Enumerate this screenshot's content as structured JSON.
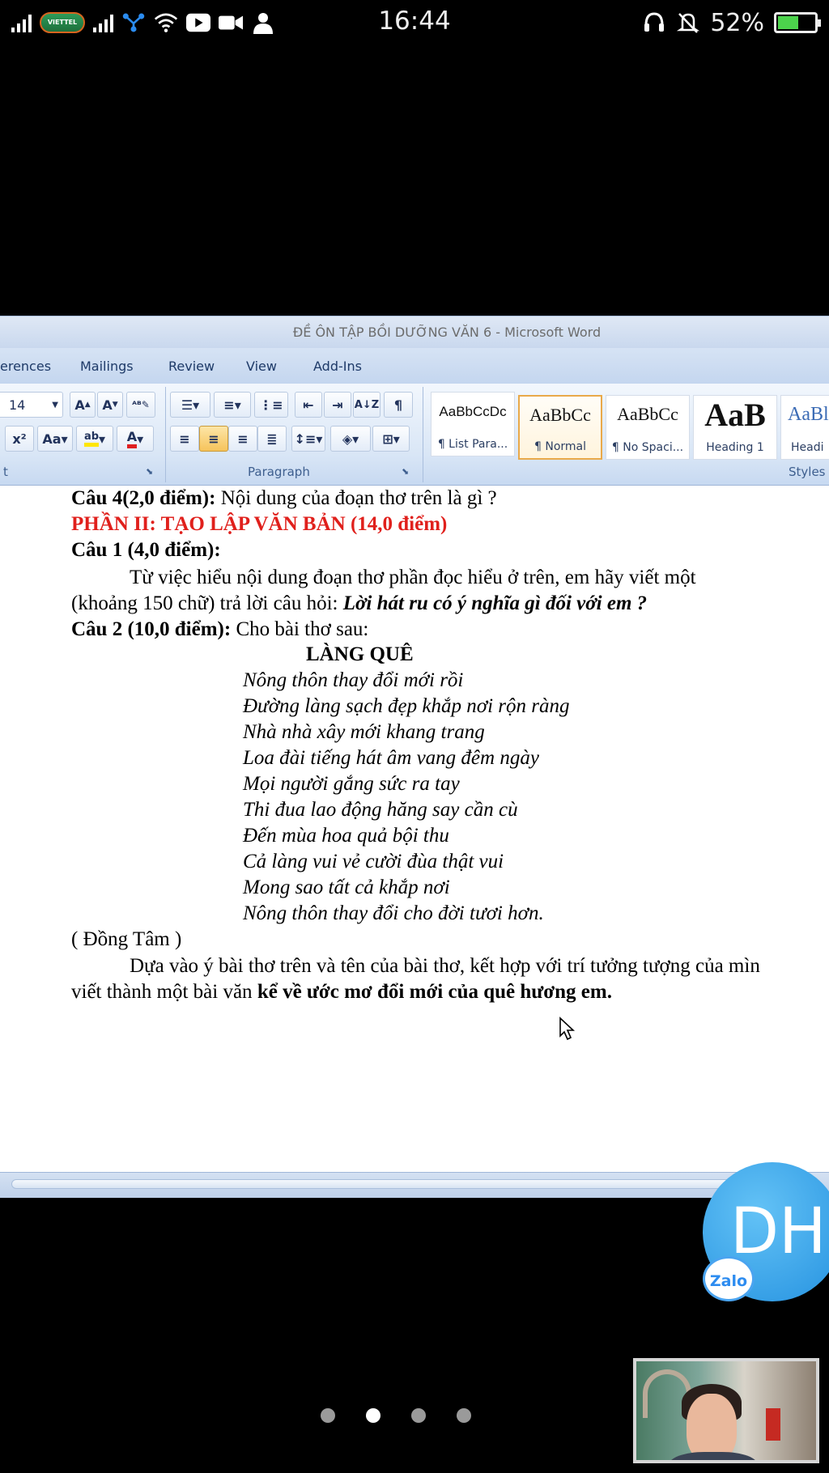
{
  "status_bar": {
    "time": "16:44",
    "battery_percent": "52%",
    "battery_level": 0.52,
    "carrier_logo": "VIETTEL",
    "icons": [
      "signal-icon",
      "carrier-logo",
      "signal-icon",
      "network-icon",
      "wifi-icon",
      "youtube-icon",
      "video-call-icon",
      "person-icon",
      "headset-icon",
      "mute-bell-icon",
      "battery-icon"
    ]
  },
  "word": {
    "title": "ĐỀ ÔN TẬP BỒI DƯỠNG VĂN 6 - Microsoft Word",
    "tabs": [
      "erences",
      "Mailings",
      "Review",
      "View",
      "Add-Ins"
    ],
    "ribbon": {
      "font_size": "14",
      "paragraph_label": "Paragraph",
      "styles_label": "Styles",
      "font_group_label": "t",
      "styles": [
        {
          "sample": "AaBbCcDc",
          "name": "¶ List Para..."
        },
        {
          "sample": "AaBbCc",
          "name": "¶ Normal"
        },
        {
          "sample": "AaBbCc",
          "name": "¶ No Spaci..."
        },
        {
          "sample": "AaB",
          "name": "Heading 1"
        },
        {
          "sample": "AaBl",
          "name": "Headi"
        }
      ]
    },
    "document": {
      "q4_bold": "Câu 4(2,0 điểm):",
      "q4_text": " Nội dung của đoạn thơ trên là gì ?",
      "part2": "PHẦN II: TẠO LẬP VĂN BẢN (14,0 điểm)",
      "q1_heading": "Câu 1 (4,0 điểm):",
      "q1_line1": "Từ việc hiểu nội dung đoạn thơ phần đọc hiểu ở trên, em hãy viết một",
      "q1_line2_plain": "(khoảng 150 chữ) trả lời câu hỏi: ",
      "q1_line2_bi": "Lời hát ru có ý nghĩa gì đối với em ?",
      "q2_bold": "Câu 2 (10,0 điểm):",
      "q2_text": " Cho bài thơ sau:",
      "poem_title": "LÀNG QUÊ",
      "poem": [
        "Nông thôn thay đổi mới rồi",
        "Đường làng sạch đẹp khắp nơi rộn ràng",
        "Nhà nhà xây mới khang trang",
        "Loa đài tiếng hát âm vang đêm ngày",
        "Mọi người gắng sức ra tay",
        "Thi đua lao động hăng say cần cù",
        "Đến mùa hoa quả bội thu",
        "Cả làng vui vẻ cười đùa thật vui",
        "Mong sao tất cả khắp nơi",
        "Nông thôn thay đổi cho đời tươi hơn."
      ],
      "author": "( Đồng Tâm )",
      "task_line1": "Dựa vào ý bài thơ trên và tên của bài thơ, kết hợp với trí tưởng tượng của mìn",
      "task_line2_plain": "viết thành một bài văn ",
      "task_line2_bold": "kể về ước mơ đổi mới của quê hương em."
    }
  },
  "overlay": {
    "avatar_initials": "DH",
    "zalo_label": "Zalo",
    "page_dots": 4,
    "active_dot": 1
  }
}
